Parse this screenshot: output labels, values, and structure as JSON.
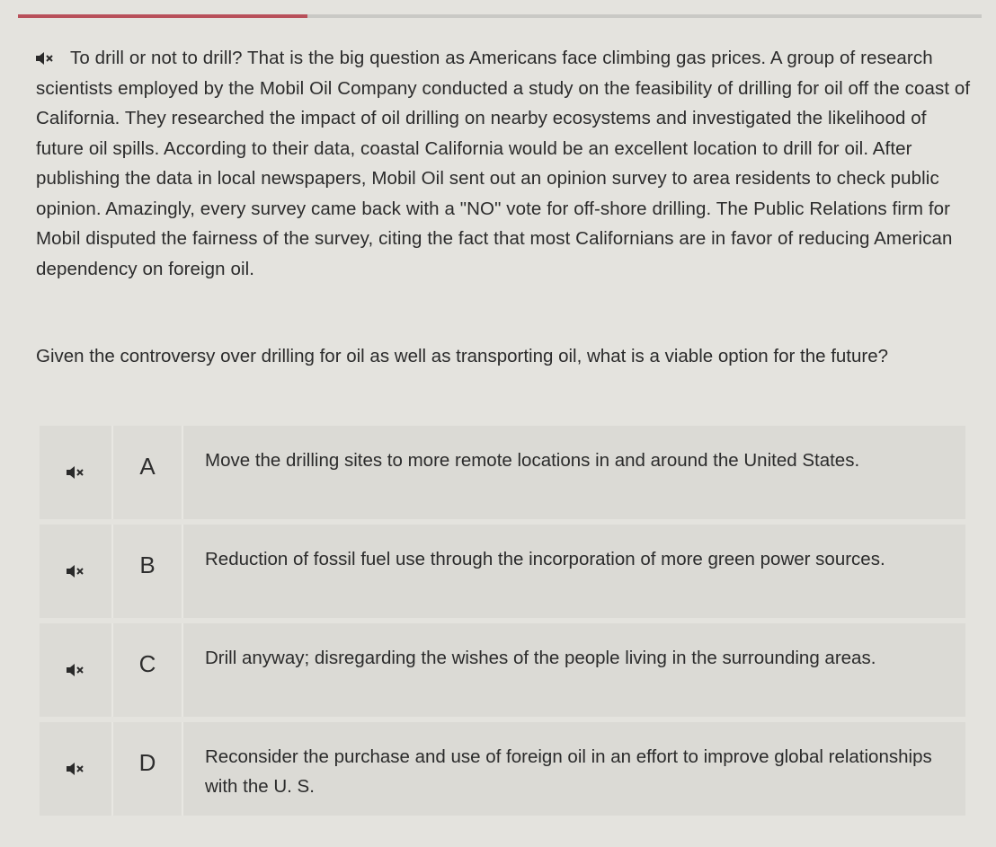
{
  "progress": {
    "fraction": 0.3
  },
  "passage": {
    "text": "To drill or not to drill? That is the big question as Americans face climbing gas prices. A group of research scientists employed by the Mobil Oil Company conducted a study on the feasibility of drilling for oil off the coast of California. They researched the impact of oil drilling on nearby ecosystems and investigated the likelihood of future oil spills. According to their data, coastal California would be an excellent location to drill for oil. After publishing the data in local newspapers, Mobil Oil sent out an opinion survey to area residents to check public opinion. Amazingly, every survey came back with a \"NO\" vote for off-shore drilling. The Public Relations firm for Mobil disputed the fairness of the survey, citing the fact that most Californians are in favor of reducing American dependency on foreign oil."
  },
  "question": {
    "text": "Given the controversy over drilling for oil as well as transporting oil, what is a viable option for the future?"
  },
  "choices": [
    {
      "letter": "A",
      "text": "Move the drilling sites to more remote locations in and around the United States."
    },
    {
      "letter": "B",
      "text": "Reduction of fossil fuel use through the incorporation of more green power sources."
    },
    {
      "letter": "C",
      "text": "Drill anyway; disregarding the wishes of the people living in the surrounding areas."
    },
    {
      "letter": "D",
      "text": "Reconsider the purchase and use of foreign oil in an effort to improve global relationships with the U. S."
    }
  ],
  "icons": {
    "audio": "speaker-muted-icon"
  },
  "colors": {
    "progress_fill": "#b8505a",
    "background": "#e4e3de"
  }
}
